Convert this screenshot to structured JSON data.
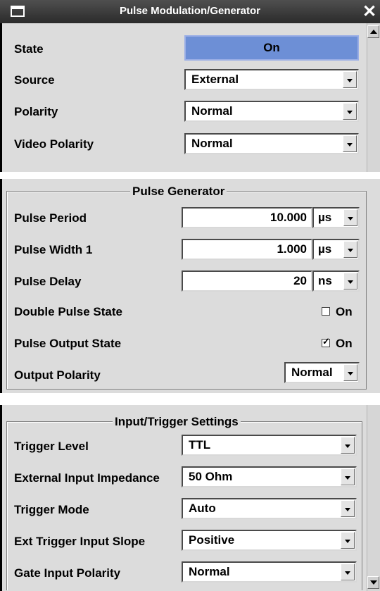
{
  "window": {
    "title": "Pulse Modulation/Generator",
    "close_glyph": "✕"
  },
  "modulation": {
    "state_label": "State",
    "state_value": "On",
    "source_label": "Source",
    "source_value": "External",
    "polarity_label": "Polarity",
    "polarity_value": "Normal",
    "video_polarity_label": "Video Polarity",
    "video_polarity_value": "Normal"
  },
  "pulse_generator": {
    "title": "Pulse Generator",
    "period_label": "Pulse Period",
    "period_value": "10.000",
    "period_unit": "µs",
    "width_label": "Pulse Width 1",
    "width_value": "1.000",
    "width_unit": "µs",
    "delay_label": "Pulse Delay",
    "delay_value": "20",
    "delay_unit": "ns",
    "double_pulse_label": "Double Pulse State",
    "double_pulse_checkbox_label": "On",
    "double_pulse_checked": false,
    "output_state_label": "Pulse Output State",
    "output_state_checkbox_label": "On",
    "output_state_checked": true,
    "output_polarity_label": "Output Polarity",
    "output_polarity_value": "Normal"
  },
  "input_trigger": {
    "title": "Input/Trigger Settings",
    "trigger_level_label": "Trigger Level",
    "trigger_level_value": "TTL",
    "ext_impedance_label": "External Input Impedance",
    "ext_impedance_value": "50 Ohm",
    "trigger_mode_label": "Trigger Mode",
    "trigger_mode_value": "Auto",
    "ext_slope_label": "Ext Trigger Input Slope",
    "ext_slope_value": "Positive",
    "gate_polarity_label": "Gate Input Polarity",
    "gate_polarity_value": "Normal"
  },
  "colors": {
    "state_on": "#6d8fd6",
    "panel": "#dcdcdc",
    "titlebar": "#3a3a3a"
  }
}
